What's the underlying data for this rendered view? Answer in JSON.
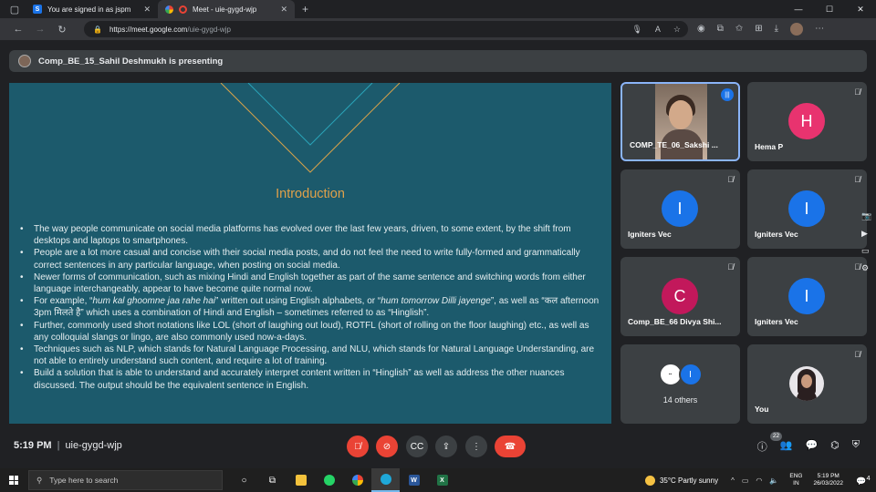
{
  "browser": {
    "tabs": [
      {
        "title": "You are signed in as jspm",
        "favicon": "S"
      },
      {
        "title": "Meet - uie-gygd-wjp"
      }
    ],
    "new_tab": "+",
    "window_controls": [
      "—",
      "☐",
      "✕"
    ],
    "address": {
      "host": "https://meet.google.com",
      "path": "/uie-gygd-wjp"
    }
  },
  "meet": {
    "presenting_banner": "Comp_BE_15_Sahil Deshmukh is presenting",
    "slide": {
      "title": "Introduction",
      "bullets": [
        {
          "text": "The way people communicate on social media platforms has evolved over the last few years, driven, to some extent, by the shift from desktops and laptops to smartphones."
        },
        {
          "text": "People are a lot more casual and concise with their social media posts, and do not feel the need to write fully-formed and grammatically correct sentences in any particular language, when posting on social media."
        },
        {
          "text": "Newer forms of communication, such as mixing Hindi and English together as part of the same sentence and switching words from either language interchangeably, appear to have become quite normal now."
        },
        {
          "pre": "For example, “",
          "it1": "hum kal ghoomne jaa rahe hai",
          "mid": "” written out using English alphabets, or “",
          "it2": "hum tomorrow Dilli jayenge",
          "post": "”, as well as “कल afternoon 3pm मिलते है” which uses a combination of Hindi and English – sometimes referred to as “Hinglish”."
        },
        {
          "text": "Further, commonly used short notations like LOL (short of laughing out loud), ROTFL (short of rolling on the floor laughing) etc., as well as any colloquial slangs or lingo, are also commonly used now-a-days."
        },
        {
          "text": "Techniques such as NLP, which stands for Natural Language Processing, and NLU, which stands for Natural Language Understanding, are not able to entirely understand such content, and require a lot of training."
        },
        {
          "text": "Build a solution that is able to understand and accurately interpret content written in “Hinglish” as well as address the other nuances discussed. The output should be the equivalent sentence in English."
        }
      ]
    },
    "participants": [
      {
        "name": "COMP_TE_06_Sakshi ...",
        "type": "video"
      },
      {
        "name": "Hema P",
        "initial": "H",
        "color": "#e8336f"
      },
      {
        "name": "Igniters Vec",
        "initial": "I",
        "color": "#1a73e8"
      },
      {
        "name": "Igniters Vec",
        "initial": "I",
        "color": "#1a73e8"
      },
      {
        "name": "Comp_BE_66 Divya Shi...",
        "initial": "C",
        "color": "#c2185b"
      },
      {
        "name": "Igniters Vec",
        "initial": "I",
        "color": "#1a73e8"
      },
      {
        "name": "",
        "others_label": "14 others",
        "initial": "I"
      },
      {
        "name": "You"
      }
    ],
    "bottom": {
      "time": "5:19 PM",
      "separator": "|",
      "meeting_code": "uie-gygd-wjp",
      "people_count": "22"
    }
  },
  "taskbar": {
    "search_placeholder": "Type here to search",
    "weather": "35°C  Partly sunny",
    "lang1": "ENG",
    "lang2": "IN",
    "time": "5:19 PM",
    "date": "26/03/2022",
    "notif_count": "4"
  }
}
